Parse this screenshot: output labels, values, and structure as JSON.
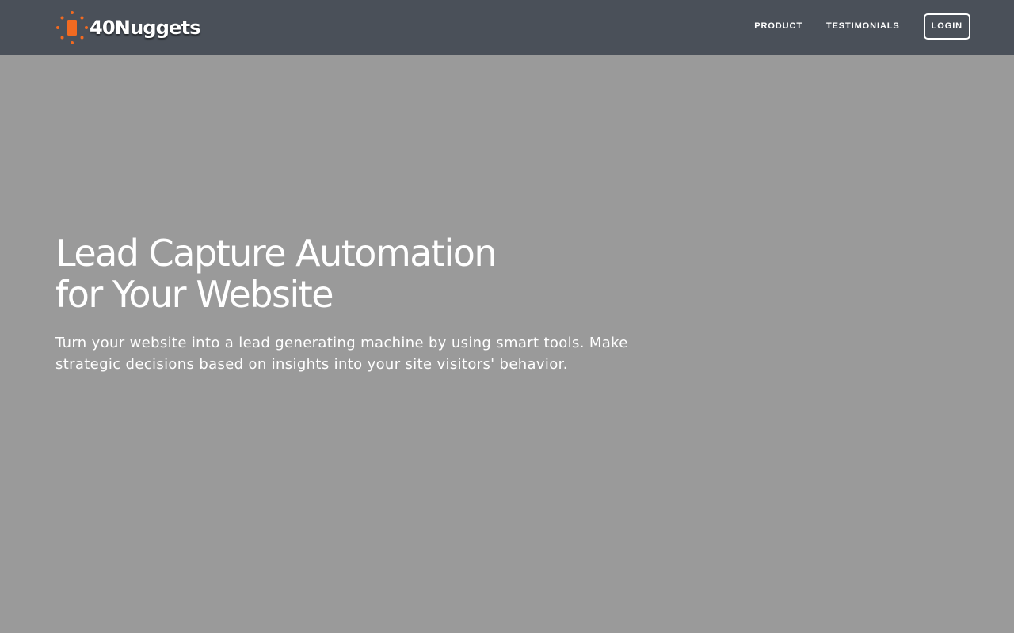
{
  "brand": {
    "name": "40Nuggets",
    "icon": "nugget-sun-icon",
    "icon_color": "#f26a21"
  },
  "nav": {
    "items": [
      {
        "label": "PRODUCT"
      },
      {
        "label": "TESTIMONIALS"
      }
    ],
    "login_label": "LOGIN"
  },
  "hero": {
    "title_line1": "Lead Capture Automation",
    "title_line2": "for Your Website",
    "subtitle": "Turn your website into a lead generating machine by using smart tools. Make strategic decisions based on insights into your site visitors' behavior."
  },
  "colors": {
    "navbar_bg": "#4a5059",
    "page_bg": "#9a9a9a",
    "text": "#ffffff",
    "accent": "#f26a21"
  }
}
